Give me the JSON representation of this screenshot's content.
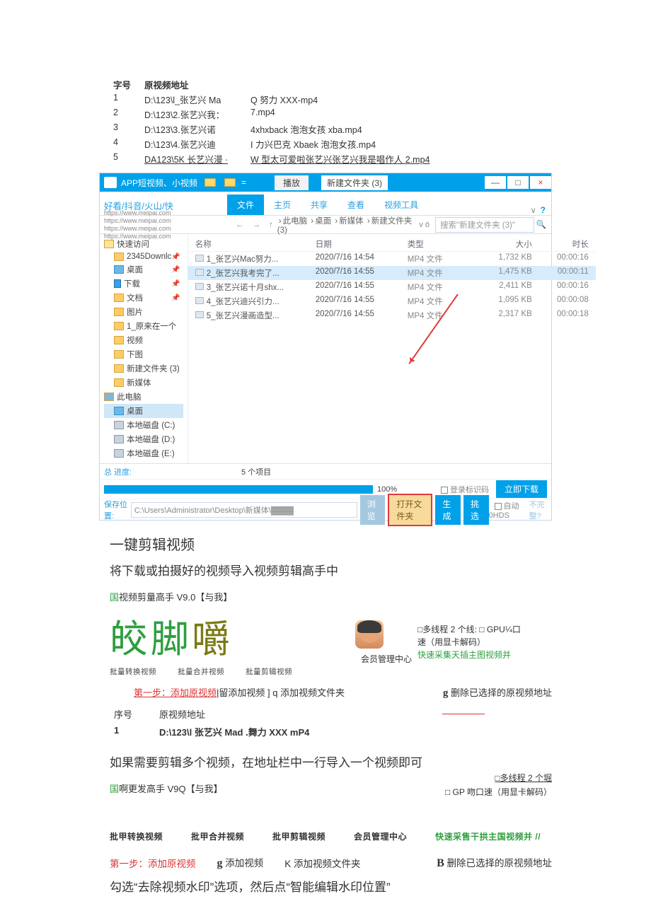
{
  "topTable": {
    "headers": [
      "字号",
      "原视频地址",
      ""
    ],
    "rows": [
      [
        "1",
        "D:\\123\\l_张艺兴 Ma",
        "Q 努力 XXX-mp4"
      ],
      [
        "2",
        "D:\\123\\2.张艺兴我：",
        "7.mp4"
      ],
      [
        "3",
        "D:\\123\\3.张艺兴诺",
        "4xhxback 泡泡女孩 xba.mp4"
      ],
      [
        "4",
        "D:\\123\\4.张艺兴迪",
        "I 力兴巴克 Xbaek 泡泡女孩.mp4"
      ],
      [
        "5",
        "DA123\\5K 长艺兴漫 ·",
        "W 型太可爱啦张艺兴张艺兴我是唱作人 2.mp4"
      ]
    ]
  },
  "explorer": {
    "titlebar": {
      "appName": "APP短视频、小视频",
      "playBtn": "播放",
      "pathLabel": "新建文件夹 (3)",
      "min": "—",
      "max": "□",
      "close": "×"
    },
    "ribbon": {
      "leftBrand": "好看/抖音/火山/快",
      "tabs": [
        "文件",
        "主页",
        "共享",
        "查看",
        "视频工具"
      ],
      "helpIcon": "?"
    },
    "nav": {
      "urls": "https://www.meipai.com\nhttps://www.meipai.com\nhttps://www.meipai.com\nhttps://www.meipai.com",
      "back": "←",
      "fwd": "→",
      "up": "↑",
      "crumbs": [
        "此电脑",
        "桌面",
        "新媒体",
        "新建文件夹 (3)"
      ],
      "refreshLabel": "v ö",
      "searchPlaceholder": "搜索\"新建文件夹 (3)\"",
      "magIcon": "🔍"
    },
    "tree": [
      {
        "lvl": 1,
        "icon": "star",
        "label": "快速访问"
      },
      {
        "lvl": 2,
        "icon": "fld",
        "label": "2345Downlc",
        "pinned": true
      },
      {
        "lvl": 2,
        "icon": "blue",
        "label": "桌面",
        "pinned": true
      },
      {
        "lvl": 2,
        "icon": "dl",
        "label": "下载",
        "pinned": true
      },
      {
        "lvl": 2,
        "icon": "fld",
        "label": "文档",
        "pinned": true
      },
      {
        "lvl": 2,
        "icon": "fld",
        "label": "图片"
      },
      {
        "lvl": 2,
        "icon": "fld",
        "label": "1_原来在一个"
      },
      {
        "lvl": 2,
        "icon": "fld",
        "label": "视频"
      },
      {
        "lvl": 2,
        "icon": "fld",
        "label": "下图"
      },
      {
        "lvl": 2,
        "icon": "fld",
        "label": "新建文件夹 (3)"
      },
      {
        "lvl": 2,
        "icon": "fld",
        "label": "新媒体"
      },
      {
        "lvl": 1,
        "icon": "pc",
        "label": "此电脑"
      },
      {
        "lvl": 2,
        "icon": "blue",
        "label": "桌面",
        "sel": true
      },
      {
        "lvl": 2,
        "icon": "drive",
        "label": "本地磁盘 (C:)"
      },
      {
        "lvl": 2,
        "icon": "drive",
        "label": "本地磁盘 (D:)"
      },
      {
        "lvl": 2,
        "icon": "drive",
        "label": "本地磁盘 (E:)"
      }
    ],
    "fileHeaders": {
      "name": "名称",
      "date": "日期",
      "type": "类型",
      "size": "大小",
      "dur": "时长"
    },
    "files": [
      {
        "name": "1_张艺兴Mac努力...",
        "date": "2020/7/16 14:54",
        "type": "MP4 文件",
        "size": "1,732 KB",
        "dur": "00:00:16"
      },
      {
        "name": "2_张艺兴我考完了...",
        "date": "2020/7/16 14:55",
        "type": "MP4 文件",
        "size": "1,475 KB",
        "dur": "00:00:11",
        "sel": true
      },
      {
        "name": "3_张艺兴诺十月shx...",
        "date": "2020/7/16 14:55",
        "type": "MP4 文件",
        "size": "2,411 KB",
        "dur": "00:00:16"
      },
      {
        "name": "4_张艺兴迪兴引力...",
        "date": "2020/7/16 14:55",
        "type": "MP4 文件",
        "size": "1,095 KB",
        "dur": "00:00:08"
      },
      {
        "name": "5_张艺兴漫画造型...",
        "date": "2020/7/16 14:55",
        "type": "MP4 文件",
        "size": "2,317 KB",
        "dur": "00:00:18"
      }
    ],
    "status": {
      "label": "总 进度:",
      "count": "5 个项目",
      "pct": "100%",
      "savePathLabel": "保存位置:",
      "savePath": "C:\\Users\\Administrator\\Desktop\\新媒体\\▓▓▓▓"
    },
    "progressOpts": {
      "o1": "登录标识码",
      "o2": "自动0HDS",
      "dlBtn": "立即下载",
      "noBtn": "不完整?"
    },
    "actionBtns": {
      "browse": "浏览",
      "open": "打开文件夹",
      "make": "生成",
      "pick": "挑选"
    }
  },
  "doc": {
    "h1": "一键剪辑视频",
    "p1": "将下载或拍摄好的视频导入视频剪辑高手中",
    "apptitle1_pre": "国",
    "apptitle1": "视频剪量高手 V9.0【与我】",
    "bigchars": "皎脚嚼",
    "memberCenter": "会员管理中心",
    "opt_multithread": "□多线程 2 个线: □ GPU¼口",
    "opt_speed": "速（用显卡解码）",
    "opt_collect": "快速采集天插主图视频并",
    "smalltabs": [
      "批量转换视频",
      "批量合并视频",
      "批量剪辑视频"
    ],
    "step1_label": "第一步：添加原视频",
    "step1_mid": "|留添加视频 ] q 添加视频文件夹",
    "del_label": "删除已选择的原视频地址",
    "del_icon": "g",
    "tbl2_h0": "序号",
    "tbl2_h1": "原视频地址",
    "tbl2_r": [
      "1",
      "D:\\123\\l 张艺兴 Mad .舞力 XXX mP4"
    ],
    "p2": "如果需要剪辑多个视频，在地址栏中一行导入一个视频即可",
    "apptitle2_pre": "国",
    "apptitle2": "啊更发高手 V9Q【与我】",
    "r2_l1": "□多线程 2 个堀",
    "r2_l2": "□ GP 吻口速（用显卡解码）",
    "tabs2": [
      "批甲转换视频",
      "批甲合并视频",
      "批甲剪辑视频",
      "会员管理中心"
    ],
    "tabs2_green": "快速采售干拱主国视频并 //",
    "step2_label": "第一步：添加原视频",
    "step2_g": "g 添加视频",
    "step2_k": "K 添加视频文件夹",
    "step2_B": "B",
    "step2_del": "删除已选择的原视频地址",
    "p3": "勾选“去除视频水印”选项，然后点“智能编辑水印位置”"
  }
}
